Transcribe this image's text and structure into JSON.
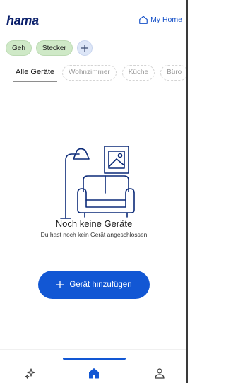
{
  "header": {
    "logo": "hama",
    "my_home_label": "My Home"
  },
  "chips": {
    "items": [
      "Geh",
      "Stecker"
    ]
  },
  "tabs": {
    "active": "Alle Geräte",
    "items": [
      "Wohnzimmer",
      "Küche",
      "Büro"
    ]
  },
  "empty_state": {
    "title": "Noch keine Geräte",
    "subtitle": "Du hast noch kein Gerät angeschlossen"
  },
  "add_button": {
    "label": "Gerät hinzufügen"
  },
  "bottom_nav": {
    "items": [
      {
        "icon": "sparkle-icon",
        "active": false
      },
      {
        "icon": "home-icon",
        "active": true
      },
      {
        "icon": "profile-icon",
        "active": false
      }
    ]
  },
  "colors": {
    "brand_blue": "#1257d4",
    "logo_navy": "#0a1f6b",
    "chip_green": "#cfe9c7",
    "chip_add_blue": "#dde6f7"
  }
}
